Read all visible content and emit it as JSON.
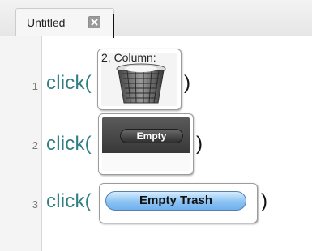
{
  "tab": {
    "title": "Untitled"
  },
  "gutter": {
    "lines": [
      "1",
      "2",
      "3"
    ]
  },
  "code": {
    "lines": [
      {
        "fn": "click(",
        "close": ")"
      },
      {
        "fn": "click(",
        "close": ")"
      },
      {
        "fn": "click(",
        "close": ")"
      }
    ]
  },
  "thumbnails": {
    "t1": {
      "text": "2, Column:",
      "icon": "trash-can-icon"
    },
    "t2": {
      "button_label": "Empty"
    },
    "t3": {
      "button_label": "Empty Trash"
    }
  },
  "colors": {
    "code": "#2f7f83",
    "paren": "#111111",
    "accent": "#8cc3f3"
  }
}
